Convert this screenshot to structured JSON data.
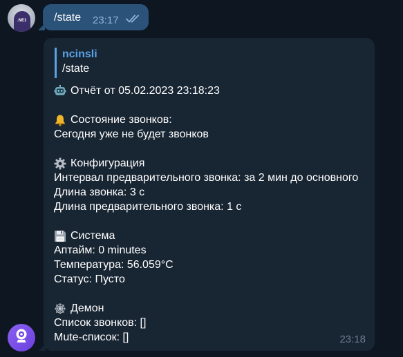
{
  "outgoing": {
    "text": "/state",
    "time": "23:17"
  },
  "incoming": {
    "reply_name": "ncinsli",
    "reply_text": "/state",
    "lines": {
      "report": "Отчёт от 05.02.2023 23:18:23",
      "bells_header": "Состояние звонков:",
      "bells_status": "Сегодня уже не будет звонков",
      "config_header": "Конфигурация",
      "config_interval": "Интервал предварительного звонка: за 2 мин до основного",
      "config_length": "Длина звонка: 3 с",
      "config_pre_length": "Длина предварительного звонка: 1 с",
      "system_header": "Система",
      "system_uptime": "Аптайм: 0 minutes",
      "system_temp": "Температура: 56.059°C",
      "system_status": "Статус: Пусто",
      "daemon_header": "Демон",
      "daemon_list": "Список звонков: []",
      "daemon_mute": "Mute-список: []"
    },
    "time": "23:18"
  },
  "avatar_user_tag": ".NE1",
  "colors": {
    "background": "#0e1621",
    "outgoing_bubble": "#2b5278",
    "incoming_bubble": "#182533",
    "accent": "#5aa3e8",
    "bot_avatar": "#7b4fee"
  },
  "icons": {
    "report": "robot-icon",
    "bells": "bell-icon",
    "config": "gear-icon",
    "system": "floppy-disk-icon",
    "daemon": "spider-web-icon",
    "read_status": "double-check-icon",
    "bot_avatar": "webcam-icon"
  }
}
